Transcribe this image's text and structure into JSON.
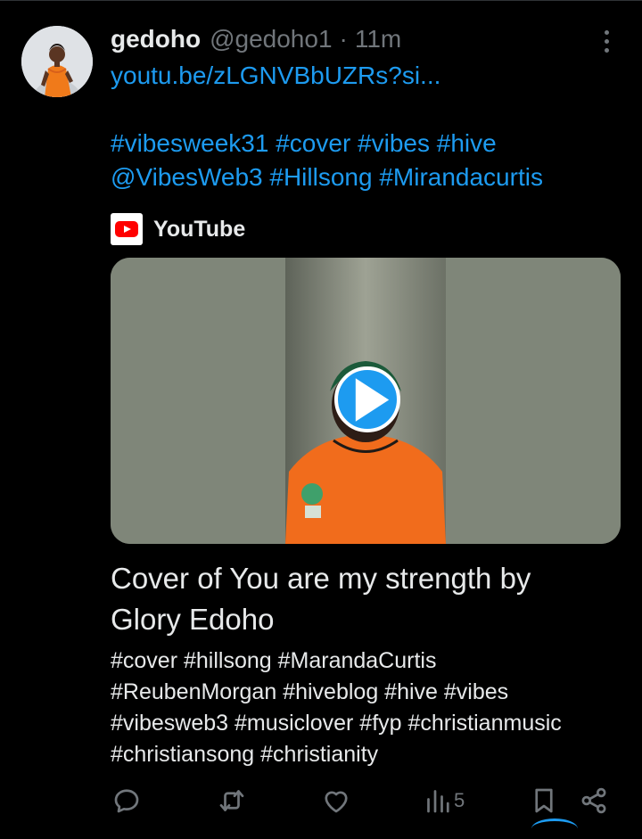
{
  "tweet": {
    "author_name": "gedoho",
    "author_handle": "@gedoho1",
    "separator": "·",
    "timestamp": "11m",
    "link_text": "youtu.be/zLGNVBbUZRs?si...",
    "hashtag_lines": [
      "#vibesweek31 #cover #vibes #hive",
      "@VibesWeb3 #Hillsong #Mirandacurtis"
    ]
  },
  "card": {
    "source_label": "YouTube",
    "title_lines": [
      "Cover of You are my strength by",
      "Glory Edoho"
    ],
    "description_lines": [
      "#cover #hillsong #MarandaCurtis",
      "#ReubenMorgan #hiveblog #hive #vibes",
      "#vibesweb3 #musiclover #fyp #christianmusic",
      "#christiansong #christianity"
    ]
  },
  "actions": {
    "views_count": "5",
    "icons": [
      "reply-icon",
      "repost-icon",
      "like-icon",
      "views-icon",
      "bookmark-icon",
      "share-icon"
    ]
  },
  "colors": {
    "background": "#000000",
    "primary_text": "#e7e9ea",
    "secondary_text": "#71767b",
    "link": "#1d9bf0",
    "youtube_red": "#ff0000"
  }
}
